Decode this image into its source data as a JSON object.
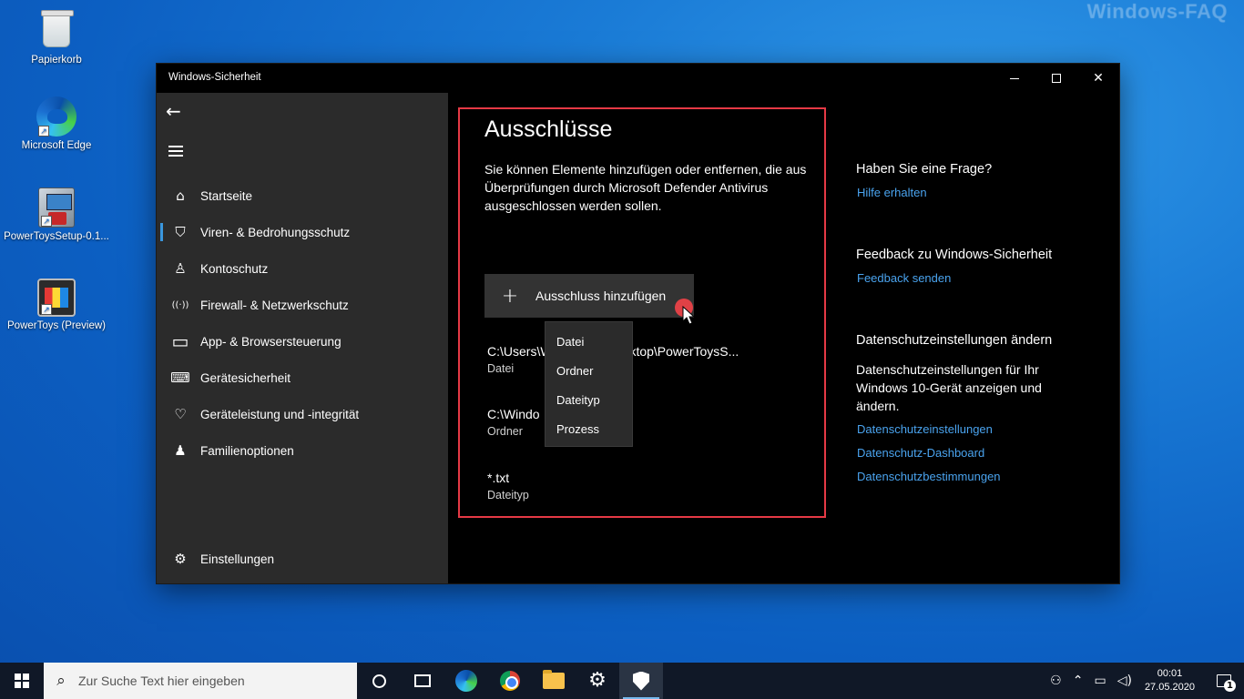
{
  "watermark": "Windows-FAQ",
  "desktop": {
    "icons": [
      {
        "label": "Papierkorb"
      },
      {
        "label": "Microsoft Edge"
      },
      {
        "label": "PowerToysSetup-0.1..."
      },
      {
        "label": "PowerToys (Preview)"
      }
    ]
  },
  "window": {
    "title": "Windows-Sicherheit",
    "controls": {
      "minimize": "minimize",
      "maximize": "maximize",
      "close": "✕"
    }
  },
  "sidebar": {
    "back_icon": "←",
    "items": [
      {
        "label": "Startseite",
        "icon": "home-icon",
        "glyph": "⌂"
      },
      {
        "label": "Viren- & Bedrohungsschutz",
        "icon": "shield-icon",
        "glyph": "⛉"
      },
      {
        "label": "Kontoschutz",
        "icon": "person-icon",
        "glyph": "♙"
      },
      {
        "label": "Firewall- & Netzwerkschutz",
        "icon": "wifi-icon",
        "glyph": "((·))"
      },
      {
        "label": "App- & Browsersteuerung",
        "icon": "browser-icon",
        "glyph": "▭"
      },
      {
        "label": "Gerätesicherheit",
        "icon": "laptop-icon",
        "glyph": "⌨"
      },
      {
        "label": "Geräteleistung und -integrität",
        "icon": "heart-icon",
        "glyph": "♡"
      },
      {
        "label": "Familienoptionen",
        "icon": "family-icon",
        "glyph": "♟"
      }
    ],
    "settings": {
      "label": "Einstellungen",
      "glyph": "⚙"
    },
    "active_index": 1
  },
  "main": {
    "heading": "Ausschlüsse",
    "description": "Sie können Elemente hinzufügen oder entfernen, die aus Überprüfungen durch Microsoft Defender Antivirus ausgeschlossen werden sollen.",
    "add_button": {
      "label": "Ausschluss hinzufügen",
      "glyph": "+"
    },
    "exclusions": [
      {
        "path": "C:\\Users\\W",
        "path_tail": "Desktop\\PowerToysS...",
        "type": "Datei"
      },
      {
        "path": "C:\\Windo",
        "path_tail": "",
        "type": "Ordner"
      },
      {
        "path": "*.txt",
        "path_tail": "",
        "type": "Dateityp"
      }
    ],
    "dropdown": [
      "Datei",
      "Ordner",
      "Dateityp",
      "Prozess"
    ]
  },
  "right_panel": {
    "question_heading": "Haben Sie eine Frage?",
    "help_link": "Hilfe erhalten",
    "feedback_heading": "Feedback zu Windows-Sicherheit",
    "feedback_link": "Feedback senden",
    "privacy_heading": "Datenschutzeinstellungen ändern",
    "privacy_text": "Datenschutzeinstellungen für Ihr Windows 10-Gerät anzeigen und ändern.",
    "privacy_links": [
      "Datenschutzeinstellungen",
      "Datenschutz-Dashboard",
      "Datenschutzbestimmungen"
    ]
  },
  "taskbar": {
    "search_placeholder": "Zur Suche Text hier eingeben",
    "time": "00:01",
    "date": "27.05.2020",
    "notification_count": "1"
  },
  "colors": {
    "highlight_border": "#e53945",
    "link": "#4aa3ee",
    "accent": "#3a96dd",
    "sidebar_bg": "#2b2b2b"
  }
}
